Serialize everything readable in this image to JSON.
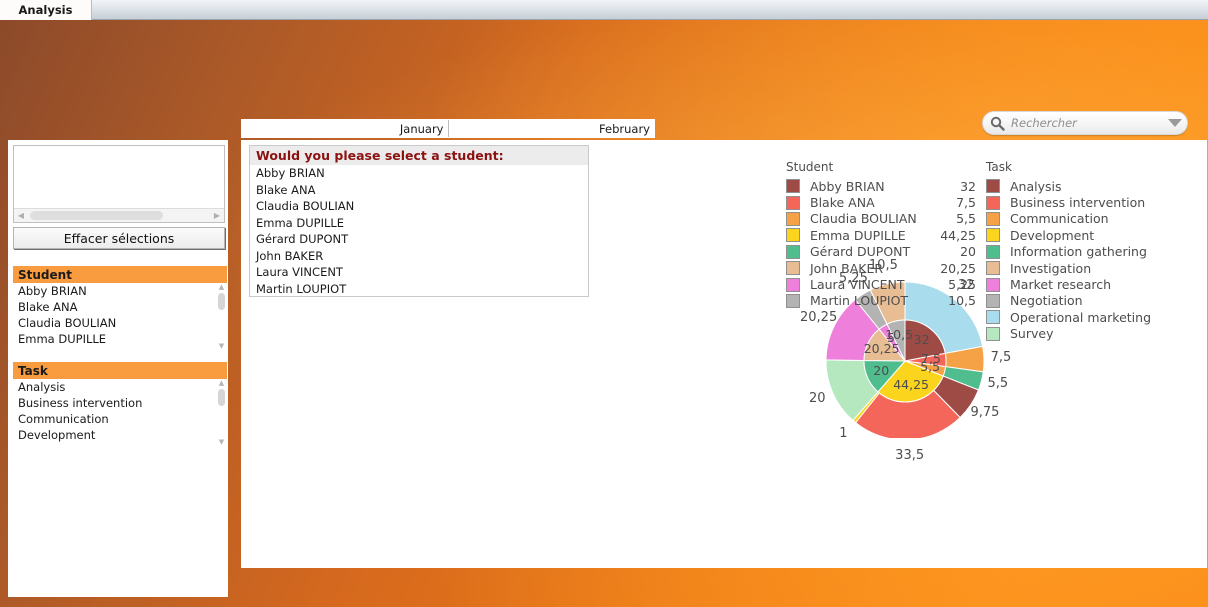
{
  "window": {
    "tab_label": "Analysis"
  },
  "search": {
    "placeholder": "Rechercher",
    "icon": "search-icon",
    "caret_icon": "chevron-down-icon"
  },
  "month_tabs": [
    {
      "label": "January"
    },
    {
      "label": "February"
    }
  ],
  "left_panel": {
    "clear_button": "Effacer sélections",
    "listboxes": [
      {
        "title": "Student",
        "items": [
          "Abby BRIAN",
          "Blake ANA",
          "Claudia BOULIAN",
          "Emma DUPILLE"
        ]
      },
      {
        "title": "Task",
        "items": [
          "Analysis",
          "Business intervention",
          "Communication",
          "Development"
        ]
      }
    ]
  },
  "selection_prompt": {
    "title": "Would you please select a student:",
    "items": [
      "Abby BRIAN",
      "Blake ANA",
      "Claudia BOULIAN",
      "Emma DUPILLE",
      "Gérard DUPONT",
      "John BAKER",
      "Laura VINCENT",
      "Martin LOUPIOT"
    ]
  },
  "legends": {
    "student": {
      "title": "Student",
      "rows": [
        {
          "label": "Abby BRIAN",
          "value": "32",
          "color": "#9e4b46"
        },
        {
          "label": "Blake ANA",
          "value": "7,5",
          "color": "#f4665a"
        },
        {
          "label": "Claudia BOULIAN",
          "value": "5,5",
          "color": "#f5a145"
        },
        {
          "label": "Emma DUPILLE",
          "value": "44,25",
          "color": "#fbd41e"
        },
        {
          "label": "Gérard DUPONT",
          "value": "20",
          "color": "#4fbd8e"
        },
        {
          "label": "John BAKER",
          "value": "20,25",
          "color": "#e8bd93"
        },
        {
          "label": "Laura VINCENT",
          "value": "5,25",
          "color": "#ee7fdb"
        },
        {
          "label": "Martin LOUPIOT",
          "value": "10,5",
          "color": "#b3b3b3"
        }
      ]
    },
    "task": {
      "title": "Task",
      "rows": [
        {
          "label": "Analysis",
          "color": "#9e4b46"
        },
        {
          "label": "Business intervention",
          "color": "#f4665a"
        },
        {
          "label": "Communication",
          "color": "#f5a145"
        },
        {
          "label": "Development",
          "color": "#fbd41e"
        },
        {
          "label": "Information gathering",
          "color": "#4fbd8e"
        },
        {
          "label": "Investigation",
          "color": "#e8bd93"
        },
        {
          "label": "Market research",
          "color": "#ee7fdb"
        },
        {
          "label": "Negotiation",
          "color": "#b3b3b3"
        },
        {
          "label": "Operational marketing",
          "color": "#a9dced"
        },
        {
          "label": "Survey",
          "color": "#b5e8bf"
        }
      ]
    }
  },
  "chart_data": {
    "type": "pie",
    "title": "",
    "rings": [
      {
        "name": "inner",
        "categories": [
          "Abby BRIAN",
          "Blake ANA",
          "Claudia BOULIAN",
          "Emma DUPILLE",
          "Gérard DUPONT",
          "John BAKER",
          "Laura VINCENT",
          "Martin LOUPIOT"
        ],
        "values": [
          32,
          7.5,
          5.5,
          44.25,
          20,
          20.25,
          5.25,
          10.5
        ],
        "labels": [
          "32",
          "7,5",
          "5,5",
          "44,25",
          "20",
          "20,25",
          "5",
          "10,5"
        ],
        "colors": [
          "#9e4b46",
          "#f4665a",
          "#f5a145",
          "#fbd41e",
          "#4fbd8e",
          "#e8bd93",
          "#ee7fdb",
          "#b3b3b3"
        ]
      },
      {
        "name": "outer",
        "categories": [
          "Operational marketing",
          "Communication",
          "Information gathering",
          "Analysis",
          "Business intervention",
          "Development",
          "Survey",
          "Market research",
          "Negotiation",
          "Investigation"
        ],
        "values": [
          32,
          7.5,
          5.5,
          9.75,
          33.5,
          1,
          20,
          20.25,
          5.25,
          10.5
        ],
        "labels": [
          "32",
          "7,5",
          "5,5",
          "9,75",
          "33,5",
          "1",
          "20",
          "20,25",
          "5,25",
          "10,5"
        ],
        "colors": [
          "#a9dced",
          "#f5a145",
          "#4fbd8e",
          "#9e4b46",
          "#f4665a",
          "#fbd41e",
          "#b5e8bf",
          "#ee7fdb",
          "#b3b3b3",
          "#e8bd93"
        ]
      }
    ]
  },
  "theme": {
    "accent": "#f7821b",
    "header_orange": "#f99b3f",
    "prompt_red": "#8c1212"
  }
}
